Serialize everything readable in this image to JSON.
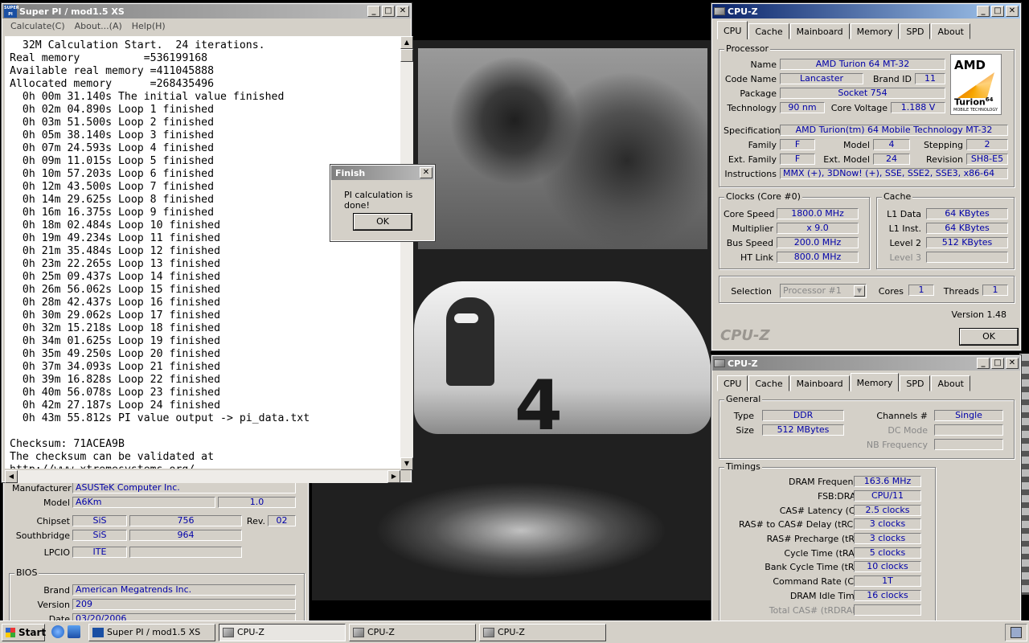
{
  "superpi": {
    "title": "Super PI / mod1.5 XS",
    "icon_text": "SUPER PI",
    "menu": [
      "Calculate(C)",
      "About...(A)",
      "Help(H)"
    ],
    "lines": [
      "  32M Calculation Start.  24 iterations.",
      "Real memory          =536199168",
      "Available real memory =411045888",
      "Allocated memory      =268435496",
      "  0h 00m 31.140s The initial value finished",
      "  0h 02m 04.890s Loop 1 finished",
      "  0h 03m 51.500s Loop 2 finished",
      "  0h 05m 38.140s Loop 3 finished",
      "  0h 07m 24.593s Loop 4 finished",
      "  0h 09m 11.015s Loop 5 finished",
      "  0h 10m 57.203s Loop 6 finished",
      "  0h 12m 43.500s Loop 7 finished",
      "  0h 14m 29.625s Loop 8 finished",
      "  0h 16m 16.375s Loop 9 finished",
      "  0h 18m 02.484s Loop 10 finished",
      "  0h 19m 49.234s Loop 11 finished",
      "  0h 21m 35.484s Loop 12 finished",
      "  0h 23m 22.265s Loop 13 finished",
      "  0h 25m 09.437s Loop 14 finished",
      "  0h 26m 56.062s Loop 15 finished",
      "  0h 28m 42.437s Loop 16 finished",
      "  0h 30m 29.062s Loop 17 finished",
      "  0h 32m 15.218s Loop 18 finished",
      "  0h 34m 01.625s Loop 19 finished",
      "  0h 35m 49.250s Loop 20 finished",
      "  0h 37m 34.093s Loop 21 finished",
      "  0h 39m 16.828s Loop 22 finished",
      "  0h 40m 56.078s Loop 23 finished",
      "  0h 42m 27.187s Loop 24 finished",
      "  0h 43m 55.812s PI value output -> pi_data.txt",
      "",
      "Checksum: 71ACEA9B",
      "The checksum can be validated at",
      "http://www.xtremesystems.org/"
    ]
  },
  "dialog": {
    "title": "Finish",
    "message": "PI calculation is done!",
    "ok": "OK"
  },
  "cpuz_main": {
    "title": "CPU-Z",
    "tabs": [
      "CPU",
      "Cache",
      "Mainboard",
      "Memory",
      "SPD",
      "About"
    ],
    "processor_label": "Processor",
    "name_label": "Name",
    "name": "AMD Turion 64 MT-32",
    "codename_label": "Code Name",
    "codename": "Lancaster",
    "brandid_label": "Brand ID",
    "brandid": "11",
    "package_label": "Package",
    "package": "Socket 754",
    "tech_label": "Technology",
    "tech": "90 nm",
    "voltage_label": "Core Voltage",
    "voltage": "1.188 V",
    "spec_label": "Specification",
    "spec": "AMD Turion(tm) 64 Mobile Technology MT-32",
    "family_label": "Family",
    "family": "F",
    "model_label": "Model",
    "model": "4",
    "stepping_label": "Stepping",
    "stepping": "2",
    "extfamily_label": "Ext. Family",
    "extfamily": "F",
    "extmodel_label": "Ext. Model",
    "extmodel": "24",
    "revision_label": "Revision",
    "revision": "SH8-E5",
    "instr_label": "Instructions",
    "instr": "MMX (+), 3DNow! (+), SSE, SSE2, SSE3, x86-64",
    "clocks_label": "Clocks (Core #0)",
    "corespeed_label": "Core Speed",
    "corespeed": "1800.0 MHz",
    "multiplier_label": "Multiplier",
    "multiplier": "x 9.0",
    "busspeed_label": "Bus Speed",
    "busspeed": "200.0 MHz",
    "htlink_label": "HT Link",
    "htlink": "800.0 MHz",
    "cache_label": "Cache",
    "l1data_label": "L1 Data",
    "l1data": "64 KBytes",
    "l1inst_label": "L1 Inst.",
    "l1inst": "64 KBytes",
    "level2_label": "Level 2",
    "level2": "512 KBytes",
    "level3_label": "Level 3",
    "level3": "",
    "selection_label": "Selection",
    "selection": "Processor #1",
    "cores_label": "Cores",
    "cores": "1",
    "threads_label": "Threads",
    "threads": "1",
    "version": "Version 1.48",
    "brand": "CPU-Z",
    "ok": "OK",
    "logo_amd": "AMD",
    "logo_turion": "Turion",
    "logo_64": "64",
    "logo_sub": "MOBILE TECHNOLOGY"
  },
  "cpuz_mem": {
    "title": "CPU-Z",
    "tabs": [
      "CPU",
      "Cache",
      "Mainboard",
      "Memory",
      "SPD",
      "About"
    ],
    "general_label": "General",
    "type_label": "Type",
    "type": "DDR",
    "size_label": "Size",
    "size": "512 MBytes",
    "channels_label": "Channels #",
    "channels": "Single",
    "dcmode_label": "DC Mode",
    "dcmode": "",
    "nbfreq_label": "NB Frequency",
    "nbfreq": "",
    "timings_label": "Timings",
    "dram_label": "DRAM Frequency",
    "dram": "163.6 MHz",
    "fsb_label": "FSB:DRAM",
    "fsb": "CPU/11",
    "cas_label": "CAS# Latency (CL)",
    "cas": "2.5 clocks",
    "rcd_label": "RAS# to CAS# Delay (tRCD)",
    "rcd": "3 clocks",
    "rp_label": "RAS# Precharge (tRP)",
    "rp": "3 clocks",
    "ras_label": "Cycle Time (tRAS)",
    "ras": "5 clocks",
    "rc_label": "Bank Cycle Time (tRC)",
    "rc": "10 clocks",
    "cr_label": "Command Rate (CR)",
    "cr": "1T",
    "idle_label": "DRAM Idle Timer",
    "idle": "16 clocks",
    "totalcas_label": "Total CAS# (tRDRAM)",
    "totalcas": ""
  },
  "cpuz_mb": {
    "manufacturer_label": "Manufacturer",
    "manufacturer": "ASUSTeK Computer Inc.",
    "model_label": "Model",
    "model": "A6Km",
    "model_rev": "1.0",
    "chipset_label": "Chipset",
    "chipset": "SiS",
    "chipset_id": "756",
    "rev_label": "Rev.",
    "rev": "02",
    "southbridge_label": "Southbridge",
    "southbridge": "SiS",
    "southbridge_id": "964",
    "lpcio_label": "LPCIO",
    "lpcio": "ITE",
    "bios_label": "BIOS",
    "brand_label": "Brand",
    "brand": "American Megatrends Inc.",
    "version_label": "Version",
    "version": "209",
    "date_label": "Date",
    "date": "03/20/2006"
  },
  "taskbar": {
    "start": "Start",
    "items": [
      "Super PI / mod1.5 XS",
      "CPU-Z",
      "CPU-Z",
      "CPU-Z"
    ]
  }
}
